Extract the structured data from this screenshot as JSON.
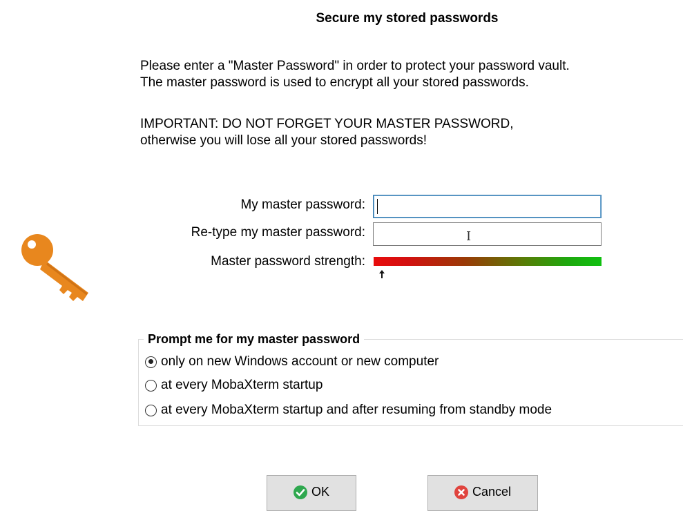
{
  "dialog": {
    "title": "Secure my stored passwords",
    "intro_line1": "Please enter a \"Master Password\" in order to protect your password vault.",
    "intro_line2": "The master password is used to encrypt all your stored passwords.",
    "important_line1": "IMPORTANT:  DO NOT FORGET YOUR MASTER PASSWORD,",
    "important_line2": "otherwise you will lose all your stored passwords!"
  },
  "form": {
    "master_label": "My master password:",
    "master_value": "",
    "retype_label": "Re-type my master password:",
    "retype_value": "",
    "strength_label": "Master password strength:",
    "strength_level": 0.0
  },
  "prompt_group": {
    "legend": "Prompt me for my master password",
    "options": [
      {
        "label": "only on new Windows account or new computer",
        "checked": true
      },
      {
        "label": "at every MobaXterm startup",
        "checked": false
      },
      {
        "label": "at every MobaXterm startup and after resuming from standby mode",
        "checked": false
      }
    ]
  },
  "buttons": {
    "ok_label": "OK",
    "cancel_label": "Cancel"
  },
  "icons": {
    "key": "key-icon",
    "ok": "check-circle-icon",
    "cancel": "x-circle-icon",
    "strength_marker": "arrow-up-icon",
    "cursor": "text-cursor-icon"
  },
  "colors": {
    "key": "#e8871e",
    "ok_icon": "#2fa84f",
    "cancel_icon": "#e0443e",
    "strength_start": "#e80c0c",
    "strength_end": "#10c010"
  }
}
